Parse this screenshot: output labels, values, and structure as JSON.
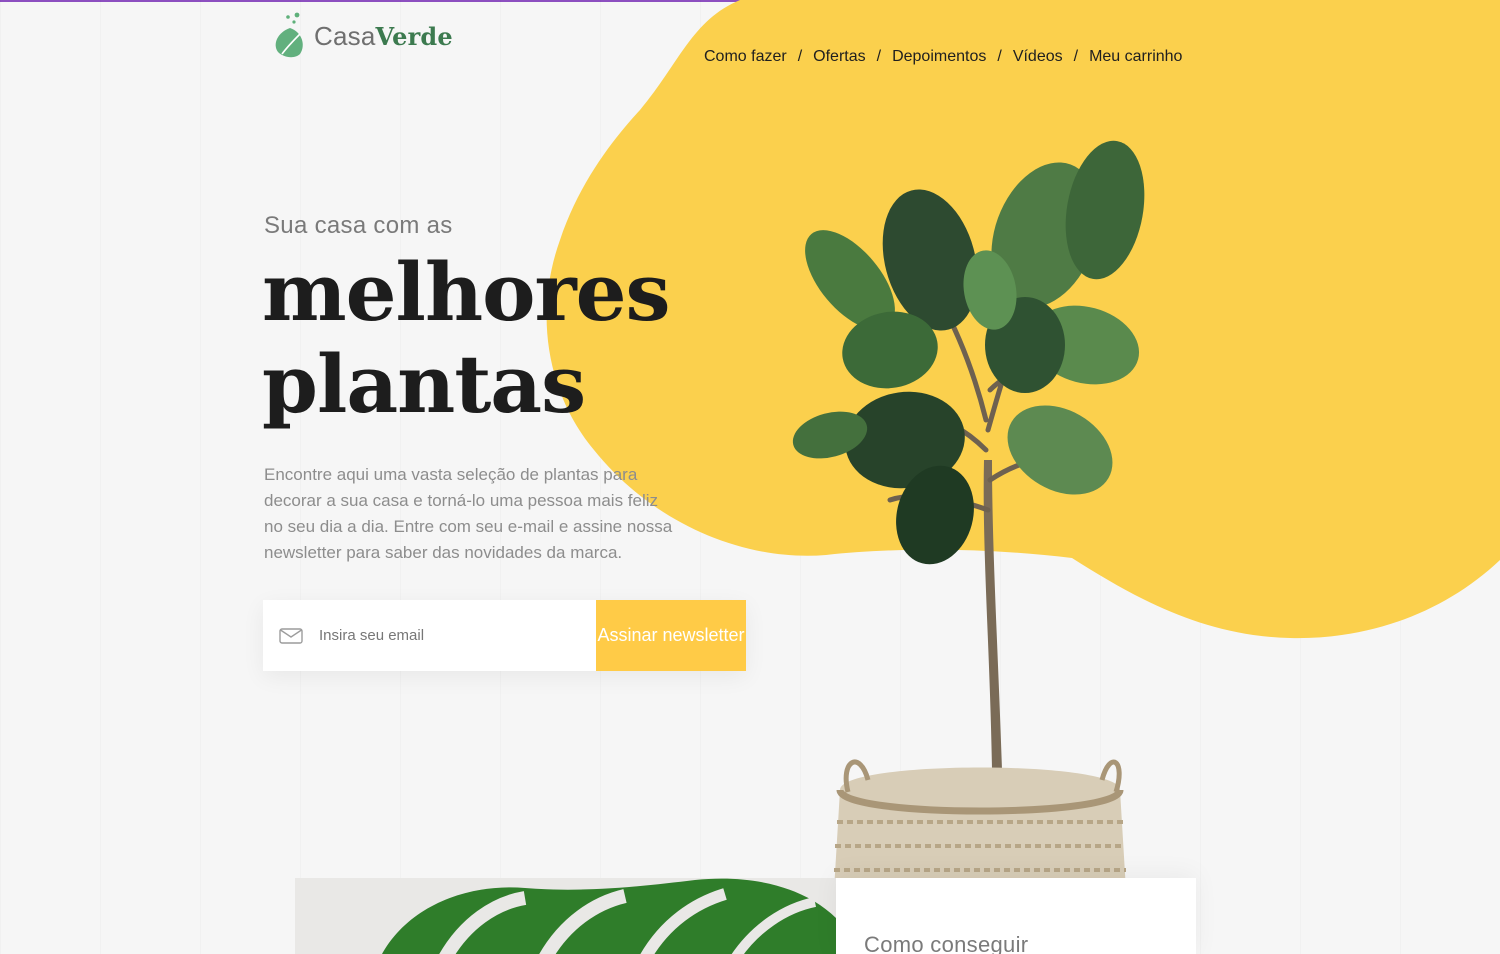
{
  "brand": {
    "name_regular": "Casa",
    "name_bold": "Verde"
  },
  "nav": {
    "items": [
      "Como fazer",
      "Ofertas",
      "Depoimentos",
      "Vídeos",
      "Meu carrinho"
    ],
    "separator": "/"
  },
  "hero": {
    "kicker": "Sua casa com as",
    "headline_line1": "melhores",
    "headline_line2": "plantas",
    "description": "Encontre aqui uma vasta seleção de plantas para decorar a sua casa e torná-lo uma pessoa mais feliz no seu dia a dia. Entre com seu e-mail e assine nossa newsletter para saber das novidades da marca."
  },
  "newsletter": {
    "placeholder": "Insira seu email",
    "button_label": "Assinar newsletter",
    "icon": "mail-icon"
  },
  "section_preview": {
    "title": "Como conseguir"
  },
  "colors": {
    "accent": "#ffcb47",
    "brand_green": "#3c7a4f",
    "text_dark": "#1d1d1d",
    "text_muted": "#8d8d8d"
  }
}
